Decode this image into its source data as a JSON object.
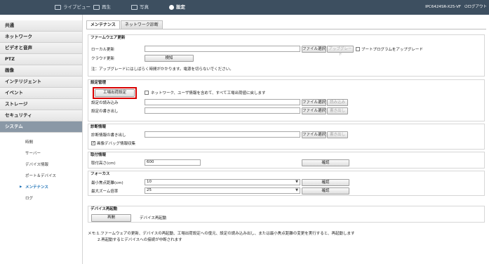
{
  "topbar": {
    "live_view": "ライブビュー",
    "playback": "再生",
    "photo": "写真",
    "settings": "設定",
    "model": "IPC6424SR-X25-VF",
    "logout": "ログアウト"
  },
  "sidebar": {
    "items": [
      {
        "label": "共通"
      },
      {
        "label": "ネットワーク"
      },
      {
        "label": "ビデオと音声"
      },
      {
        "label": "PTZ"
      },
      {
        "label": "画像"
      },
      {
        "label": "インテリジェント"
      },
      {
        "label": "イベント"
      },
      {
        "label": "ストレージ"
      },
      {
        "label": "セキュリティ"
      },
      {
        "label": "システム"
      }
    ],
    "sub_items": [
      {
        "label": "時間"
      },
      {
        "label": "サーバー"
      },
      {
        "label": "デバイス情報"
      },
      {
        "label": "ポート＆デバイス"
      },
      {
        "label": "メンテナンス"
      },
      {
        "label": "ログ"
      }
    ]
  },
  "tabs": [
    "メンテナンス",
    "ネットワーク診断"
  ],
  "firmware": {
    "title": "ファームウエア更新",
    "local_label": "ローカル更新",
    "file_select": "ファイル選択",
    "upgrade": "アップグレード",
    "boot_upgrade": "ブートプログラムをアップグレード",
    "cloud_label": "クラウド更新",
    "detect": "検知",
    "note": "注：アップグレードにはしばらく時間がかかります。電源を切らないでください。"
  },
  "config": {
    "title": "設定管理",
    "factory_reset": "工場出荷設定",
    "reset_option": "ネットワーク、ユーザ情報を含めて、すべて工場出荷値に戻します",
    "import_label": "設定の読み込み",
    "import_btn": "読み込み",
    "export_label": "設定の書き出し",
    "export_btn": "書き出し",
    "file_select": "ファイル選択"
  },
  "diagnosis": {
    "title": "診断情報",
    "export_label": "診断情報の書き出し",
    "file_select": "ファイル選択",
    "export_btn": "書き出し",
    "image_debug": "画像デバッグ情報収集"
  },
  "install": {
    "title": "取付情報",
    "height_label": "取付高さ(cm)",
    "height_value": "600",
    "confirm": "確認"
  },
  "focus": {
    "title": "フォーカス",
    "min_dist_label": "最小焦点距離(cm)",
    "min_dist_value": "10",
    "max_zoom_label": "最大ズーム倍率",
    "max_zoom_value": "25",
    "confirm": "確認"
  },
  "reboot": {
    "title": "デバイス再起動",
    "button": "再開",
    "label": "デバイス再起動"
  },
  "footer_note": {
    "line1": "メモ:1.ファームウェアの更新、デバイスの再起動、工場出荷設定への復元、設定の読み込み出し、または最小焦点距離の変更を実行すると、再起動します",
    "line2": "2.再起動するとデバイスへの接続が中断されます"
  },
  "colors": {
    "topbar": "#3d4f60",
    "active_menu": "#8a98a6",
    "highlight": "#d80000",
    "active_sub": "#1a6fb5"
  }
}
